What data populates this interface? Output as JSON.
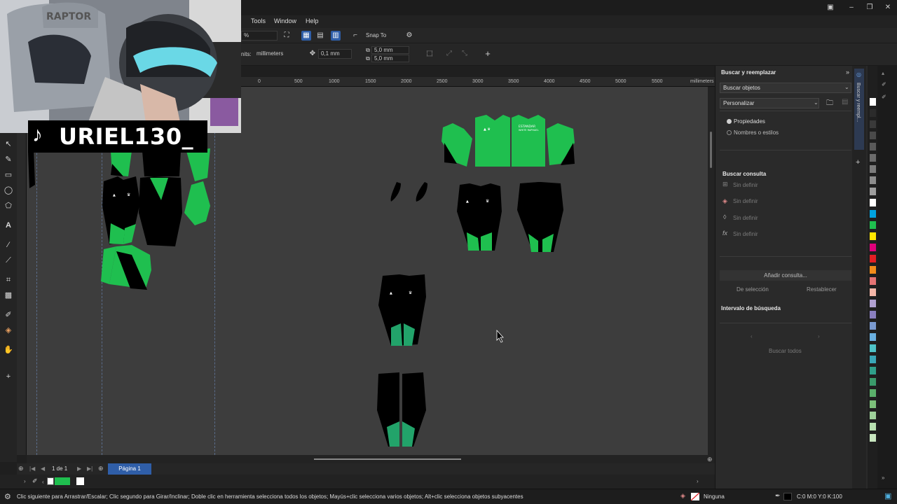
{
  "menu": {
    "tools": "Tools",
    "window": "Window",
    "help": "Help"
  },
  "toolbar": {
    "zoom": "%",
    "snap_to": "Snap To",
    "units_label": "nits:",
    "units_value": "millimeters",
    "nudge": "0,1 mm",
    "dup_x": "5,0 mm",
    "dup_y": "5,0 mm"
  },
  "ruler": {
    "ticks": [
      "0",
      "500",
      "1000",
      "1500",
      "2000",
      "2500",
      "3000",
      "3500",
      "4000",
      "4500",
      "5000",
      "5500"
    ],
    "unit": "millimeters"
  },
  "overlay": {
    "tiktok_handle": "URIEL130_"
  },
  "docker": {
    "title": "Buscar y reemplazar",
    "mode_select": "Buscar objetos",
    "preset_select": "Personalizar",
    "radio_properties": "Propiedades",
    "radio_names": "Nombres o estilos",
    "query_heading": "Buscar consulta",
    "query_rows": [
      "Sin definir",
      "Sin definir",
      "Sin definir",
      "Sin definir"
    ],
    "add_query": "Añadir consulta...",
    "from_selection": "De selección",
    "reset": "Restablecer",
    "range_heading": "Intervalo de búsqueda",
    "find_all": "Buscar todos",
    "tab_label": "Buscar y reempl..."
  },
  "pages": {
    "counter": "1 de 1",
    "tab": "Página 1"
  },
  "status": {
    "hint": "Clic siguiente para Arrastrar/Escalar; Clic segundo para Girar/Inclinar; Doble clic en herramienta selecciona todos los objetos; Mayús+clic selecciona varios objetos; Alt+clic selecciona objetos subyacentes",
    "fill": "Ninguna",
    "outline_color": "C:0 M:0 Y:0 K:100"
  },
  "colors": {
    "kit_green": "#1fbf4f",
    "kit_teal": "#22a36a",
    "accent": "#2f5ea8",
    "canvas": "#3d3d3d"
  },
  "palette": [
    "#ffffff",
    "#2b2b2b",
    "#3a3a3a",
    "#4a4a4a",
    "#5a5a5a",
    "#6b6b6b",
    "#7c7c7c",
    "#8d8d8d",
    "#9e9e9e",
    "#ffffff",
    "#00a3e0",
    "#1fbf4f",
    "#ffe600",
    "#e0007a",
    "#e31e24",
    "#f28c1a",
    "#e57373",
    "#f4b6a8",
    "#b0a0d0",
    "#8a7fc0",
    "#7a9ad0",
    "#6ab0e0",
    "#4fc3c8",
    "#3aa7b7",
    "#2fa08a",
    "#3a9a6a",
    "#5ab06a",
    "#7cc07a",
    "#9ed09a",
    "#b8e0b0",
    "#c8e6c0"
  ]
}
